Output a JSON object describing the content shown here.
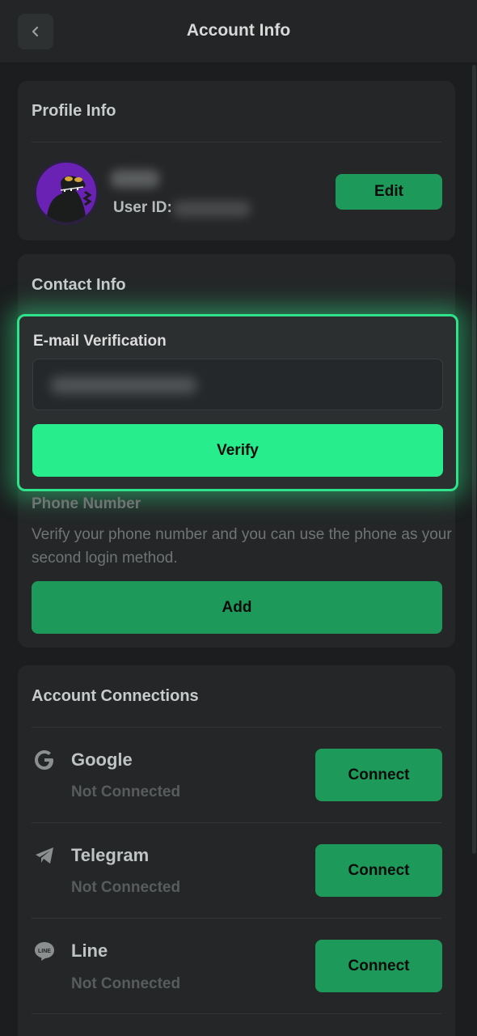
{
  "header": {
    "title": "Account Info"
  },
  "profile": {
    "title": "Profile Info",
    "user_id_label": "User ID:",
    "edit_label": "Edit"
  },
  "contact": {
    "title": "Contact Info",
    "email_label": "E-mail Verification",
    "verify_label": "Verify",
    "phone_label": "Phone Number",
    "phone_description": "Verify your phone number and you can use the phone as your second login method.",
    "add_label": "Add"
  },
  "connections": {
    "title": "Account Connections",
    "items": [
      {
        "name": "Google",
        "status": "Not Connected",
        "button": "Connect",
        "icon": "google-icon"
      },
      {
        "name": "Telegram",
        "status": "Not Connected",
        "button": "Connect",
        "icon": "telegram-icon"
      },
      {
        "name": "Line",
        "status": "Not Connected",
        "button": "Connect",
        "icon": "line-icon"
      }
    ]
  },
  "colors": {
    "background": "#1b1d1e",
    "card": "#242627",
    "accent": "#27ed8c",
    "button": "#1d9a59"
  }
}
